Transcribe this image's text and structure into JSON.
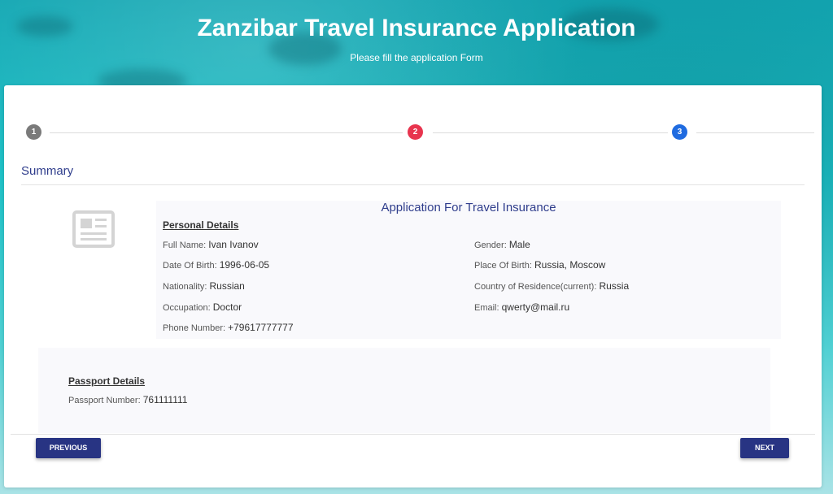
{
  "header": {
    "title": "Zanzibar Travel Insurance Application",
    "subtitle": "Please fill the application Form"
  },
  "stepper": {
    "steps": [
      {
        "label": "1",
        "color": "#7a7a7a"
      },
      {
        "label": "2",
        "color": "#e8344e"
      },
      {
        "label": "3",
        "color": "#1f6be0"
      }
    ]
  },
  "summary": {
    "heading": "Summary",
    "icon": "newspaper-icon",
    "application_title": "Application For Travel Insurance",
    "personal": {
      "title": "Personal Details",
      "full_name_label": "Full Name:",
      "full_name": "Ivan Ivanov",
      "gender_label": "Gender:",
      "gender": "Male",
      "dob_label": "Date Of Birth:",
      "dob": "1996-06-05",
      "pob_label": "Place Of Birth:",
      "pob": "Russia, Moscow",
      "nationality_label": "Nationality:",
      "nationality": "Russian",
      "residence_label": "Country of Residence(current):",
      "residence": "Russia",
      "occupation_label": "Occupation:",
      "occupation": "Doctor",
      "email_label": "Email:",
      "email": "qwerty@mail.ru",
      "phone_label": "Phone Number:",
      "phone": "+79617777777"
    },
    "passport": {
      "title": "Passport Details",
      "number_label": "Passport Number:",
      "number": "761111111"
    }
  },
  "nav": {
    "previous_label": "PREVIOUS",
    "next_label": "NEXT"
  },
  "colors": {
    "accent": "#283483",
    "heading": "#2f3d8c"
  }
}
